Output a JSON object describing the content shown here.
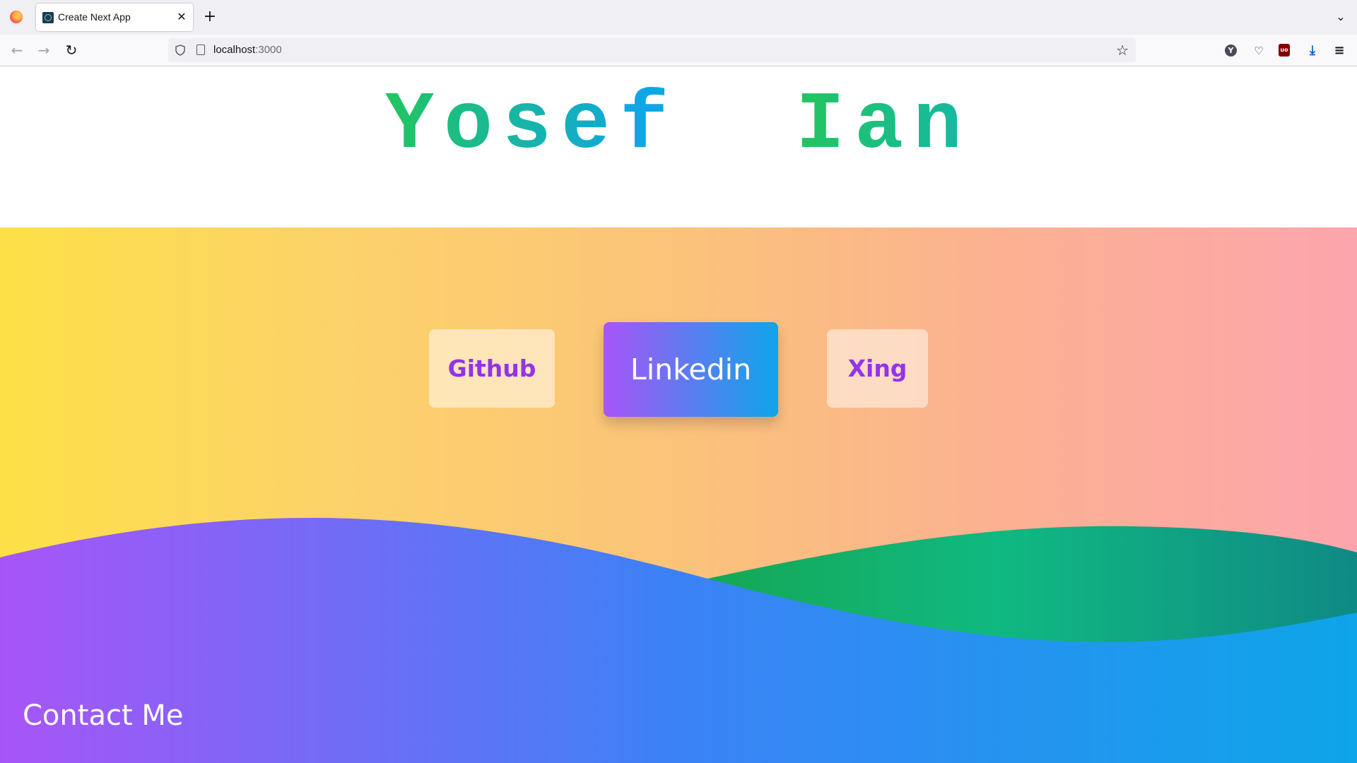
{
  "browser": {
    "tab_title": "Create Next App",
    "url_host": "localhost",
    "url_port": ":3000"
  },
  "hero": {
    "title": "Yosef  Ian"
  },
  "links": {
    "github": "Github",
    "linkedin": "Linkedin",
    "xing": "Xing"
  },
  "footer": {
    "heading": "Contact Me"
  },
  "colors": {
    "accent_purple": "#9333ea",
    "gradient_start_yellow": "#fde047",
    "gradient_end_pink": "#fca5ad",
    "wave_purple": "#a855f7",
    "wave_blue": "#0ea5e9",
    "wave_green": "#10b981"
  }
}
